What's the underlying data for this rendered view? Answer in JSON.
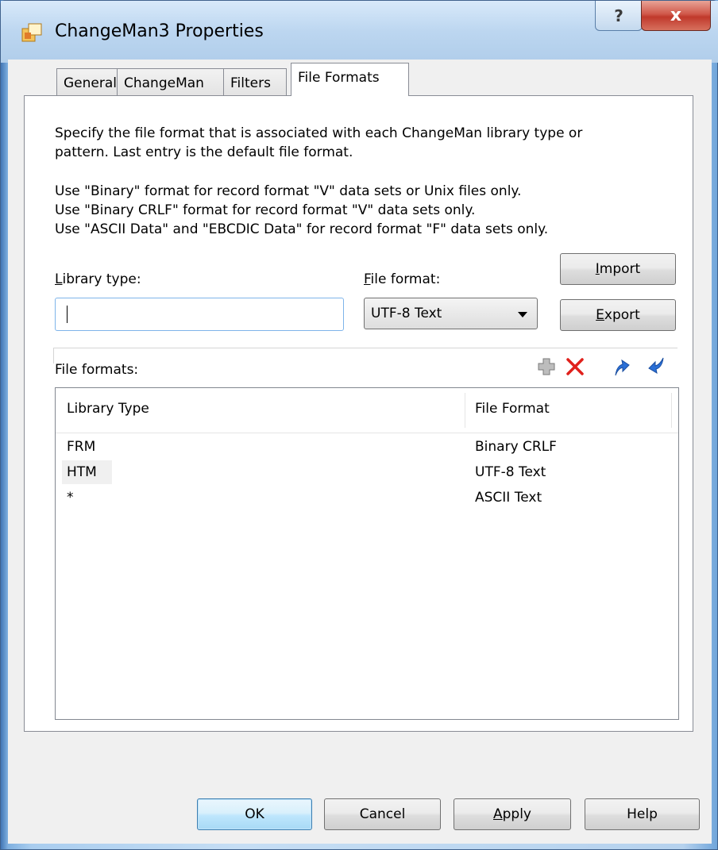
{
  "window": {
    "title": "ChangeMan3 Properties",
    "help_label": "?",
    "close_label": "x"
  },
  "tabs": [
    {
      "label": "General"
    },
    {
      "label": "ChangeMan"
    },
    {
      "label": "Filters"
    },
    {
      "label": "File Formats",
      "active": true
    }
  ],
  "description": {
    "line1": "Specify the file format that is associated with each ChangeMan library type or",
    "line2": "pattern.  Last entry is the default file format.",
    "line3": "Use \"Binary\" format for record format \"V\" data sets or Unix files only.",
    "line4": "Use \"Binary CRLF\" format for record format \"V\" data sets only.",
    "line5": "Use \"ASCII Data\" and \"EBCDIC Data\" for record format \"F\" data sets only."
  },
  "form": {
    "library_type": {
      "label_first": "L",
      "label_rest": "ibrary type:",
      "value": ""
    },
    "file_format": {
      "label_first": "F",
      "label_rest": "ile format:",
      "selected": "UTF-8 Text"
    },
    "import_first": "I",
    "import_rest": "mport",
    "export_first": "E",
    "export_rest": "xport"
  },
  "list": {
    "label": "File formats:",
    "columns": [
      "Library Type",
      "File Format"
    ],
    "rows": [
      {
        "library_type": "FRM",
        "file_format": "Binary CRLF"
      },
      {
        "library_type": "HTM",
        "file_format": "UTF-8 Text"
      },
      {
        "library_type": "*",
        "file_format": "ASCII Text"
      }
    ],
    "toolbar_icons": [
      "add-icon",
      "delete-icon",
      "move-up-icon",
      "move-down-icon"
    ]
  },
  "footer": {
    "ok": "OK",
    "cancel": "Cancel",
    "apply_first": "A",
    "apply_rest": "pply",
    "help": "Help"
  },
  "colors": {
    "delete": "#e0201b",
    "move": "#2a6fd6",
    "add": "#8a8a8a"
  }
}
